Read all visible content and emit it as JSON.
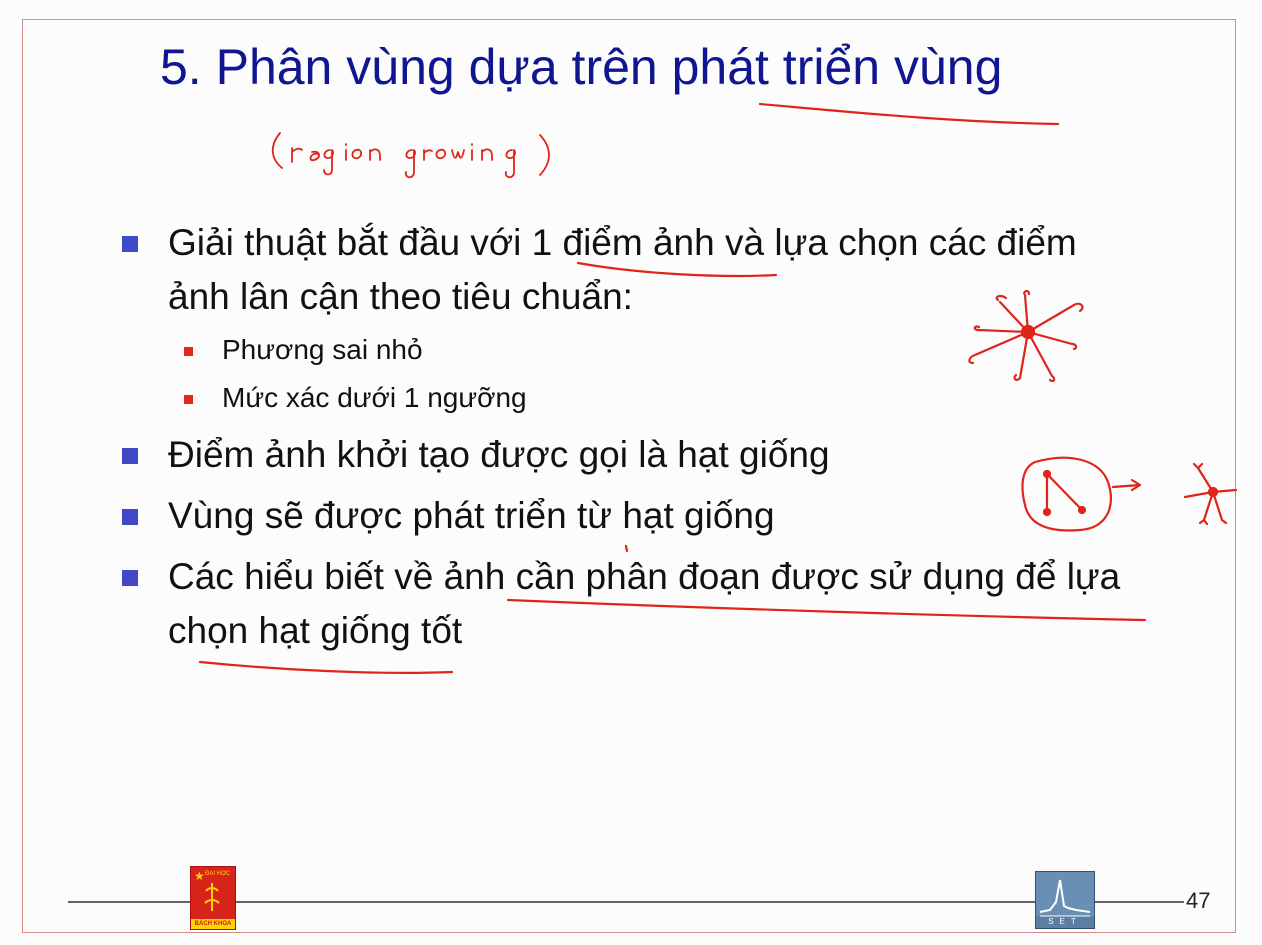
{
  "slide": {
    "title": "5. Phân vùng dựa trên phát triển vùng",
    "handwritten_note": "(region growing)",
    "bullets": [
      {
        "text_line1": "Giải thuật bắt đầu với 1 điểm ảnh và lựa chọn các điểm",
        "text_line2": "ảnh lân cận theo tiêu chuẩn:"
      },
      {
        "text": "Điểm ảnh khởi tạo được gọi là hạt giống"
      },
      {
        "text": "Vùng sẽ được phát triển từ hạt giống"
      },
      {
        "text_line1": "Các hiểu biết về ảnh cần phân đoạn được sử dụng để lựa",
        "text_line2": "chọn hạt giống tốt"
      }
    ],
    "sub_bullets": [
      {
        "text": "Phương sai nhỏ"
      },
      {
        "text": "Mức xác dưới 1 ngưỡng"
      }
    ],
    "page_number": "47"
  },
  "footer": {
    "left_logo": {
      "top_text": "ĐẠI HỌC",
      "band_text": "BÁCH KHOA"
    },
    "right_logo": {
      "letters": "SET"
    }
  },
  "colors": {
    "title": "#0f1690",
    "bullet_marker": "#3f4ac4",
    "sub_bullet_marker": "#e02a1c",
    "ink": "#e0241a",
    "frame": "#d98b8b"
  },
  "icons": {
    "bullet": "square-bullet-icon",
    "sub_bullet": "square-bullet-icon",
    "left_logo": "university-logo-icon",
    "right_logo": "set-logo-icon"
  }
}
